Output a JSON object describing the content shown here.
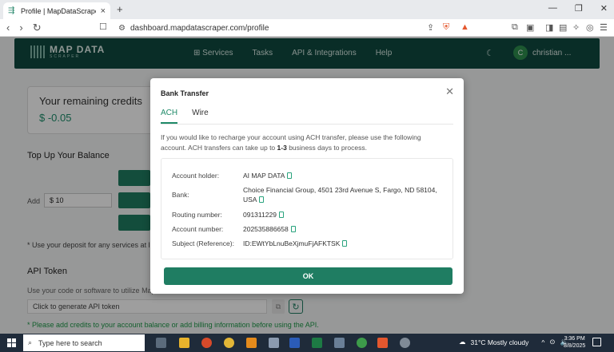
{
  "browser": {
    "tab_title": "Profile | MapDataScraper",
    "url": "dashboard.mapdatascraper.com/profile",
    "new_tab": "+",
    "close": "×",
    "win_min": "—",
    "win_max": "❐",
    "win_close": "✕"
  },
  "site": {
    "logo_main": "MAP DATA",
    "logo_sub": "SCRAPER",
    "nav": [
      "Services",
      "Tasks",
      "API & Integrations",
      "Help"
    ],
    "user_initial": "C",
    "user_name": "christian ..."
  },
  "profile": {
    "credits_label": "Your remaining credits",
    "credits_value": "$ -0.05",
    "topup_title": "Top Up Your Balance",
    "add_label": "Add",
    "add_value": "$ 10",
    "deposit_note": "* Use your deposit for any services at lis",
    "api_title": "API Token",
    "api_sub": "Use your code or software to utilize Map",
    "generate_placeholder": "Click to generate API token",
    "warning": "* Please add credits to your account balance or add billing information before using the API."
  },
  "modal": {
    "title": "Bank Transfer",
    "tabs": [
      "ACH",
      "Wire"
    ],
    "desc_1": "If you would like to recharge your account using ACH transfer, please use the following",
    "desc_2_pre": "account. ACH transfers can take up to ",
    "desc_2_bold": "1-3",
    "desc_2_post": " business days to process.",
    "rows": [
      {
        "key": "Account holder:",
        "value": "AI MAP DATA"
      },
      {
        "key": "Bank:",
        "value": "Choice Financial Group, 4501 23rd Avenue S, Fargo, ND 58104, USA"
      },
      {
        "key": "Routing number:",
        "value": "091311229"
      },
      {
        "key": "Account number:",
        "value": "202535886658"
      },
      {
        "key": "Subject (Reference):",
        "value": "ID:EWtYbLnuBeXjmuFjAFKTSK"
      }
    ],
    "ok_label": "OK"
  },
  "taskbar": {
    "search_placeholder": "Type here to search",
    "weather": "31°C  Mostly cloudy",
    "time": "3:36 PM",
    "date": "8/8/2025"
  },
  "colors": {
    "brand_dark": "#0f4a40",
    "brand_green": "#1f7d62",
    "accent": "#1f8a68"
  }
}
